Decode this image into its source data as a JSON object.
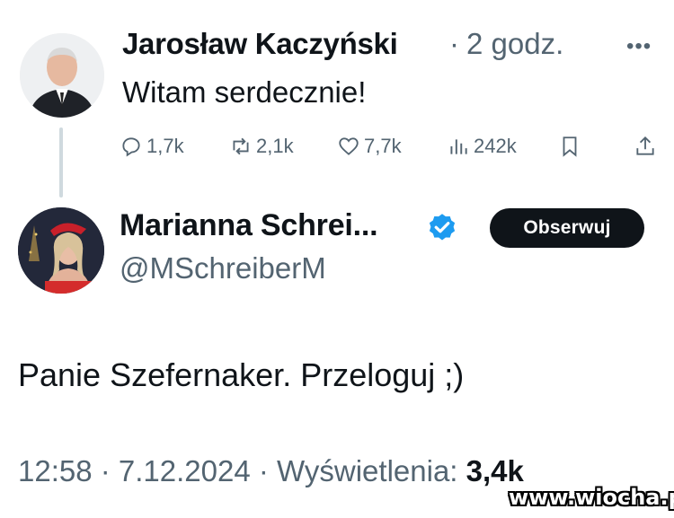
{
  "tweet1": {
    "author_name": "Jarosław Kaczyński",
    "separator": "·",
    "time_ago": "2 godz.",
    "more_icon": "more-icon",
    "text": "Witam serdecznie!",
    "actions": {
      "replies": "1,7k",
      "reposts": "2,1k",
      "likes": "7,7k",
      "views": "242k"
    }
  },
  "tweet2": {
    "author_name": "Marianna Schrei...",
    "handle": "@MSchreiberM",
    "follow_label": "Obserwuj",
    "text": "Panie Szefernaker. Przeloguj ;)",
    "timestamp": "12:58 · 7.12.2024 · Wyświetlenia:",
    "views_count": "3,4k",
    "verified_color": "#1d9bf0"
  },
  "watermark": "www.wiocha.pl"
}
